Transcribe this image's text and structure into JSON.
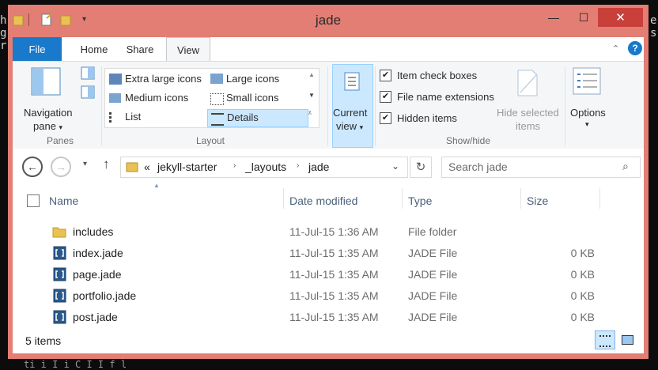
{
  "window": {
    "title": "jade"
  },
  "background_terminal": {
    "line_bottom": "ti  i I i  C   I    I f  l        "
  },
  "ribbon_tabs": [
    "File",
    "Home",
    "Share",
    "View"
  ],
  "ribbon": {
    "panes": {
      "navigation_pane_label_1": "Navigation",
      "navigation_pane_label_2": "pane",
      "group_label": "Panes"
    },
    "layout": {
      "options": [
        "Extra large icons",
        "Large icons",
        "Medium icons",
        "Small icons",
        "List",
        "Details"
      ],
      "selected": "Details",
      "group_label": "Layout"
    },
    "current_view": {
      "label_1": "Current",
      "label_2": "view"
    },
    "show_hide": {
      "item_check_boxes": "Item check boxes",
      "file_name_extensions": "File name extensions",
      "hidden_items": "Hidden items",
      "hide_selected_1": "Hide selected",
      "hide_selected_2": "items",
      "group_label": "Show/hide"
    },
    "options": {
      "label": "Options"
    }
  },
  "address": {
    "breadcrumb": [
      "«",
      "jekyll-starter",
      "_layouts",
      "jade"
    ],
    "search_placeholder": "Search jade"
  },
  "columns": [
    "Name",
    "Date modified",
    "Type",
    "Size"
  ],
  "files": [
    {
      "name": "includes",
      "date": "11-Jul-15 1:36 AM",
      "type": "File folder",
      "size": "",
      "icon": "folder-icon"
    },
    {
      "name": "index.jade",
      "date": "11-Jul-15 1:35 AM",
      "type": "JADE File",
      "size": "0 KB",
      "icon": "jade-file-icon"
    },
    {
      "name": "page.jade",
      "date": "11-Jul-15 1:35 AM",
      "type": "JADE File",
      "size": "0 KB",
      "icon": "jade-file-icon"
    },
    {
      "name": "portfolio.jade",
      "date": "11-Jul-15 1:35 AM",
      "type": "JADE File",
      "size": "0 KB",
      "icon": "jade-file-icon"
    },
    {
      "name": "post.jade",
      "date": "11-Jul-15 1:35 AM",
      "type": "JADE File",
      "size": "0 KB",
      "icon": "jade-file-icon"
    }
  ],
  "status": {
    "item_count": "5 items"
  },
  "colors": {
    "titlebar": "#e27e74",
    "close": "#c9403a",
    "file_tab": "#1979ca",
    "selected": "#cce8ff"
  }
}
